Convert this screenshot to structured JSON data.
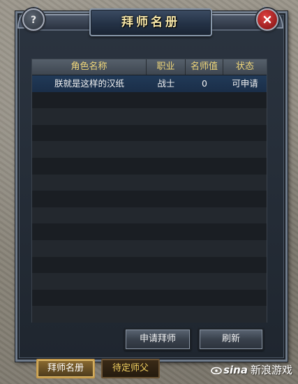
{
  "window": {
    "title": "拜师名册"
  },
  "table": {
    "columns": [
      "角色名称",
      "职业",
      "名师值",
      "状态"
    ],
    "rows": [
      {
        "name": "朕就是这样的汉纸",
        "class": "战士",
        "mentor_value": "0",
        "status": "可申请"
      }
    ]
  },
  "buttons": {
    "apply": "申请拜师",
    "refresh": "刷新"
  },
  "tabs": {
    "apply_list": "拜师名册",
    "waiting": "待定师父"
  },
  "watermark": {
    "logo": "sina",
    "text": "新浪游戏"
  },
  "colors": {
    "header_text": "#f0d77a",
    "title_text": "#f6e6a8",
    "selected_row": "#213a58"
  }
}
